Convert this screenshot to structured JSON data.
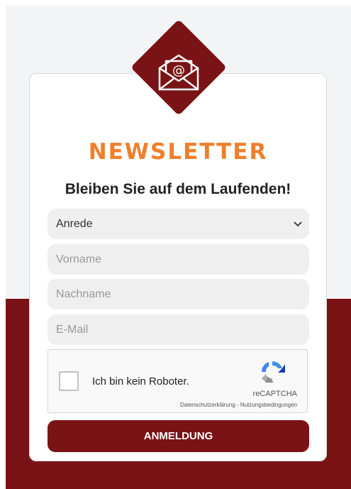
{
  "newsletter": {
    "title": "NEWSLETTER",
    "subtitle": "Bleiben Sie auf dem Laufenden!",
    "icon": "email-envelope-icon"
  },
  "form": {
    "salutation": {
      "selected": "Anrede"
    },
    "first_name": {
      "placeholder": "Vorname",
      "value": ""
    },
    "last_name": {
      "placeholder": "Nachname",
      "value": ""
    },
    "email": {
      "placeholder": "E-Mail",
      "value": ""
    },
    "submit_label": "ANMELDUNG"
  },
  "captcha": {
    "checkbox_label": "Ich bin kein Roboter.",
    "brand": "reCAPTCHA",
    "privacy": "Datenschutzerklärung",
    "separator": "-",
    "terms": "Nutzungsbedingungen"
  },
  "colors": {
    "brand_dark_red": "#7a1315",
    "title_orange": "#f07f2c",
    "field_bg": "#efefef"
  }
}
